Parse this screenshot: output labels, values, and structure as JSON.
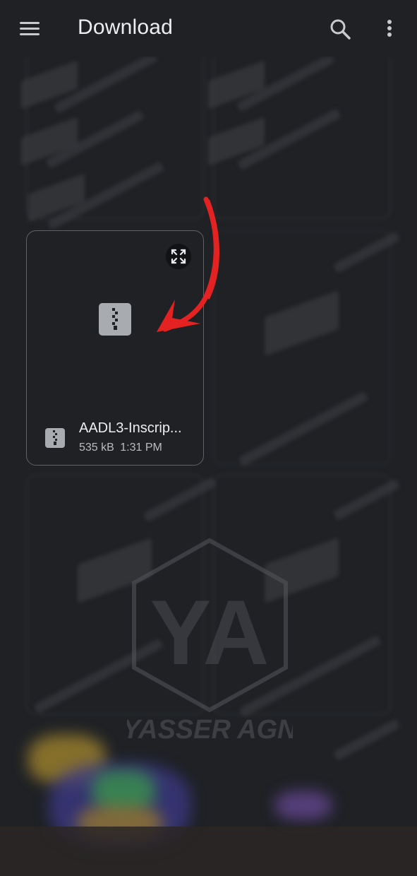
{
  "appbar": {
    "title": "Download",
    "menu_icon": "hamburger-menu-icon",
    "search_icon": "search-icon",
    "more_icon": "more-vert-icon"
  },
  "file_card": {
    "name": "AADL3-Inscrip...",
    "size": "535 kB",
    "time": "1:31 PM",
    "type_icon": "zip-file-icon",
    "expand_icon": "expand-icon"
  },
  "watermark": {
    "brand": "YASSER AGN",
    "monogram": "YA"
  },
  "colors": {
    "background": "#1f2125",
    "card_border": "#5f6368",
    "annotation_arrow": "#e52222",
    "icon_gray": "#a8abb0"
  }
}
